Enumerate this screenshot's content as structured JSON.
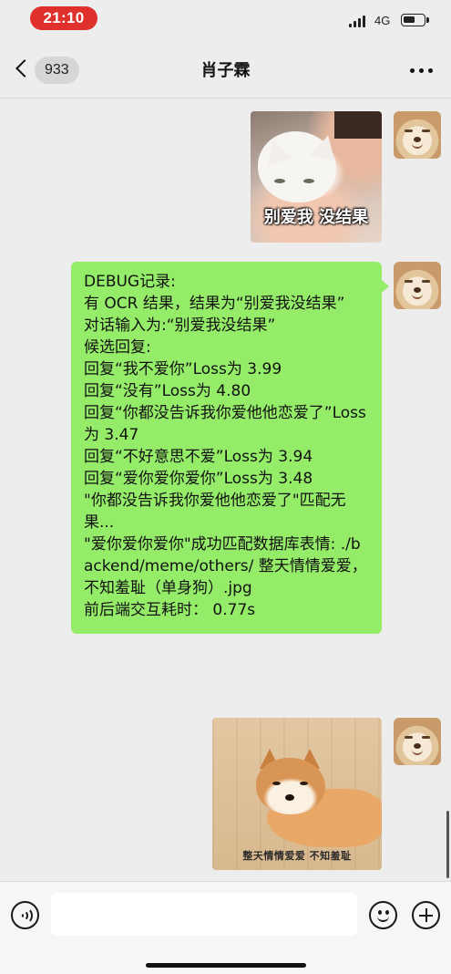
{
  "status_bar": {
    "time": "21:10",
    "network": "4G",
    "battery_level": 0.6,
    "icons": [
      "signal-icon",
      "battery-icon"
    ]
  },
  "nav": {
    "back_count": "933",
    "title": "肖子霖",
    "icons": [
      "back-chevron-icon",
      "more-icon"
    ]
  },
  "messages": [
    {
      "type": "sticker",
      "sender": "self",
      "caption": "别爱我 没结果"
    },
    {
      "type": "text",
      "sender": "self",
      "text": "DEBUG记录:\n有 OCR 结果，结果为“别爱我没结果”\n对话输入为:“别爱我没结果”\n候选回复:\n回复“我不爱你”Loss为 3.99\n回复“没有”Loss为 4.80\n回复“你都没告诉我你爱他他恋爱了”Loss为 3.47\n回复“不好意思不爱”Loss为 3.94\n回复“爱你爱你爱你”Loss为 3.48\n\"你都没告诉我你爱他他恋爱了\"匹配无果...\n\"爱你爱你爱你\"成功匹配数据库表情: ./backend/meme/others/ 整天情情爱爱，不知羞耻（单身狗）.jpg\n前后端交互耗时： 0.77s"
    },
    {
      "type": "sticker",
      "sender": "self",
      "caption": "整天情情爱爱   不知羞耻"
    }
  ],
  "input_bar": {
    "value": "",
    "placeholder": "",
    "icons": [
      "voice-icon",
      "emoji-icon",
      "plus-icon"
    ]
  },
  "colors": {
    "bubble_self": "#95ec69",
    "background": "#ededed",
    "time_pill": "#e0302b"
  }
}
